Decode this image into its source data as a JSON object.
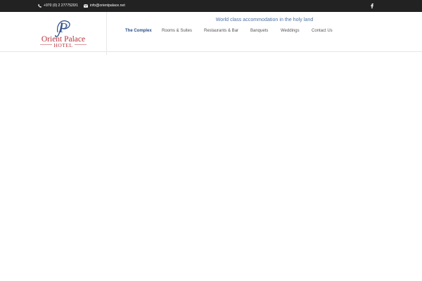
{
  "topbar": {
    "phone": "+970 (0) 2 2777520/1",
    "email": "info@orientpalace.net",
    "social_icon": "facebook-icon"
  },
  "header": {
    "logo_text_line1": "Orient Palace",
    "logo_text_line2": "HOTEL",
    "logo_monogram": "P",
    "tagline": "World class accommodation in the holy land"
  },
  "nav": {
    "items": [
      {
        "label": "The Complex",
        "active": true
      },
      {
        "label": "Rooms & Suites",
        "active": false
      },
      {
        "label": "Restaurants & Bar",
        "active": false
      },
      {
        "label": "Banquets",
        "active": false
      },
      {
        "label": "Weddings",
        "active": false
      },
      {
        "label": "Contact Us",
        "active": false
      }
    ]
  },
  "colors": {
    "topbar_bg": "#222222",
    "accent": "#2a4d86",
    "tagline": "#4a6fa5",
    "logo_red": "#b6323b"
  }
}
